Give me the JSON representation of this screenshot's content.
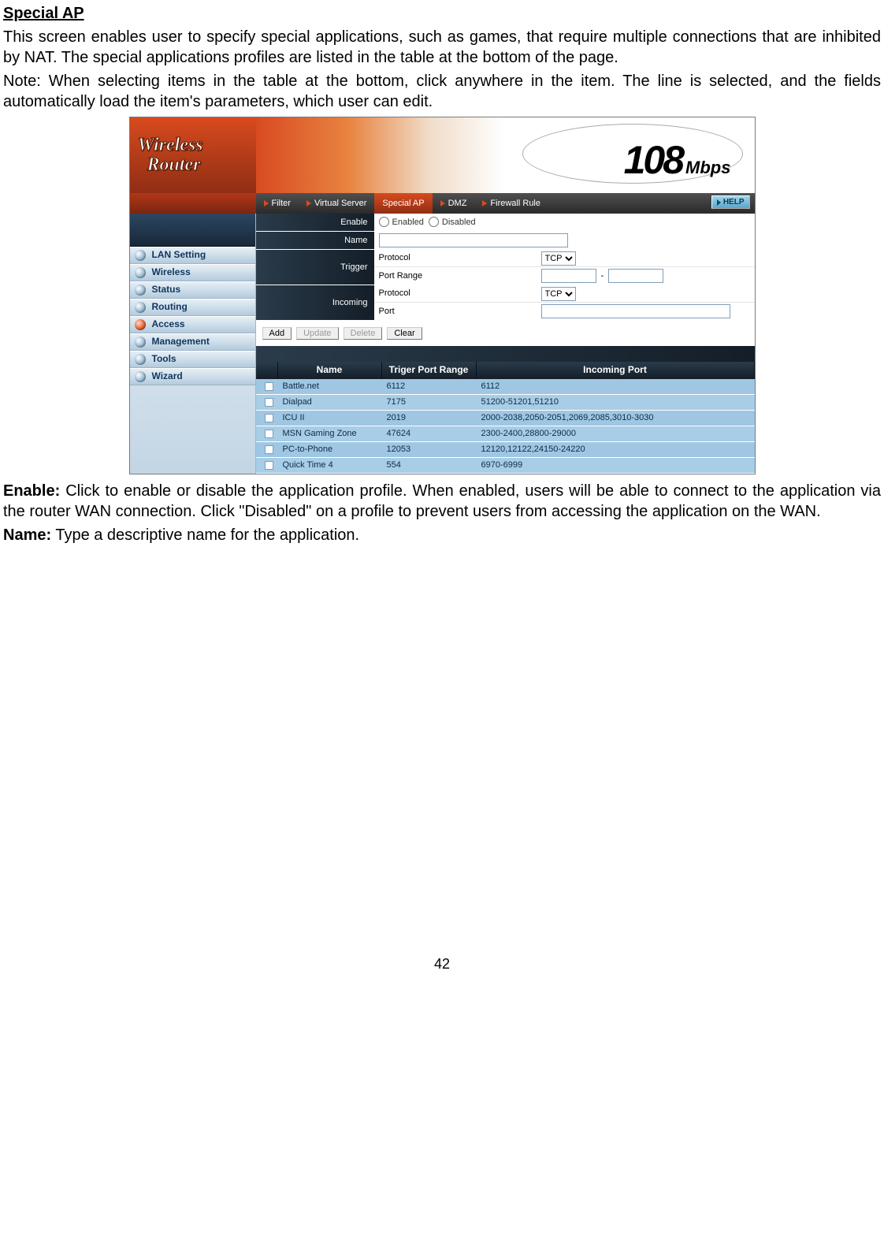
{
  "doc": {
    "section_title": "Special AP",
    "intro_p1": "This screen enables user to specify special applications, such as games, that require multiple connections that are inhibited by NAT. The special applications profiles are listed in the table at the bottom of the page.",
    "intro_p2": "Note: When selecting items in the table at the bottom, click anywhere in the item. The line is selected, and the fields automatically load the item's parameters, which user can edit.",
    "enable_label": "Enable:",
    "enable_desc": " Click to enable or disable the application profile. When enabled, users will be able to connect to the application via the router WAN connection. Click \"Disabled\" on a profile to prevent users from accessing the application on the WAN.",
    "name_label": "Name:",
    "name_desc": " Type a descriptive name for the application.",
    "page_number": "42"
  },
  "banner": {
    "line1": "Wireless",
    "line2": "Router",
    "logo_num": "108",
    "logo_unit": "Mbps"
  },
  "tabs": {
    "filter": "Filter",
    "virtual_server": "Virtual Server",
    "special_ap": "Special AP",
    "dmz": "DMZ",
    "firewall_rule": "Firewall Rule",
    "help": "HELP"
  },
  "sidebar": {
    "items": [
      {
        "label": "LAN Setting",
        "active": false
      },
      {
        "label": "Wireless",
        "active": false
      },
      {
        "label": "Status",
        "active": false
      },
      {
        "label": "Routing",
        "active": false
      },
      {
        "label": "Access",
        "active": true
      },
      {
        "label": "Management",
        "active": false
      },
      {
        "label": "Tools",
        "active": false
      },
      {
        "label": "Wizard",
        "active": false
      }
    ]
  },
  "form": {
    "enable_label": "Enable",
    "enabled_option": "Enabled",
    "disabled_option": "Disabled",
    "name_label": "Name",
    "name_value": "",
    "trigger_label": "Trigger",
    "incoming_label": "Incoming",
    "protocol_label": "Protocol",
    "port_range_label": "Port Range",
    "port_label": "Port",
    "tcp": "TCP",
    "range_sep": "-",
    "trigger_from": "",
    "trigger_to": "",
    "incoming_port": "",
    "btn_add": "Add",
    "btn_update": "Update",
    "btn_delete": "Delete",
    "btn_clear": "Clear"
  },
  "table": {
    "headers": {
      "name": "Name",
      "trigger": "Triger Port Range",
      "incoming": "Incoming Port"
    },
    "rows": [
      {
        "name": "Battle.net",
        "trigger": "6112",
        "incoming": "6112"
      },
      {
        "name": "Dialpad",
        "trigger": "7175",
        "incoming": "51200-51201,51210"
      },
      {
        "name": "ICU II",
        "trigger": "2019",
        "incoming": "2000-2038,2050-2051,2069,2085,3010-3030"
      },
      {
        "name": "MSN Gaming Zone",
        "trigger": "47624",
        "incoming": "2300-2400,28800-29000"
      },
      {
        "name": "PC-to-Phone",
        "trigger": "12053",
        "incoming": "12120,12122,24150-24220"
      },
      {
        "name": "Quick Time 4",
        "trigger": "554",
        "incoming": "6970-6999"
      }
    ]
  }
}
